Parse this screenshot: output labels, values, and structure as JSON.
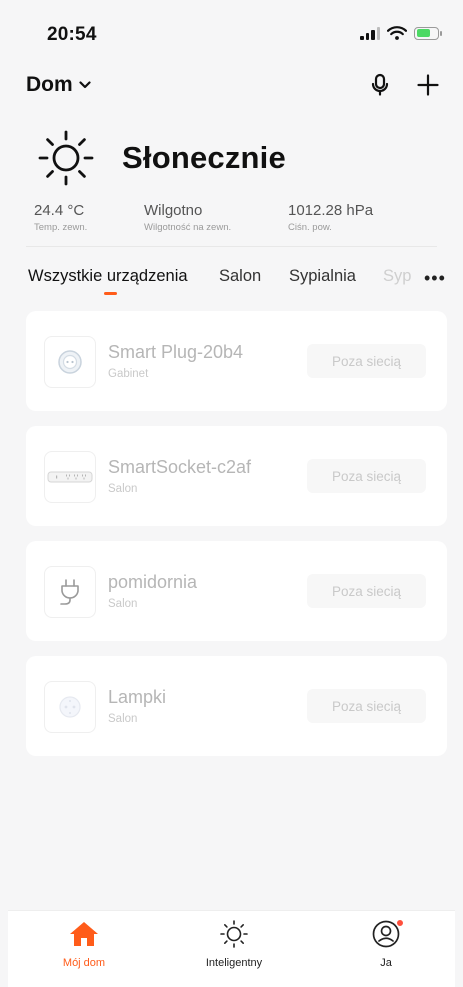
{
  "status_bar": {
    "time": "20:54"
  },
  "header": {
    "home_name": "Dom"
  },
  "weather": {
    "condition": "Słonecznie",
    "metrics": [
      {
        "value": "24.4 °C",
        "label": "Temp. zewn."
      },
      {
        "value": "Wilgotno",
        "label": "Wilgotność na zewn."
      },
      {
        "value": "1012.28 hPa",
        "label": "Ciśn. pow."
      }
    ]
  },
  "tabs": {
    "items": [
      {
        "label": "Wszystkie urządzenia"
      },
      {
        "label": "Salon"
      },
      {
        "label": "Sypialnia"
      },
      {
        "label": "Syp"
      }
    ],
    "more": "•••"
  },
  "devices": [
    {
      "name": "Smart Plug-20b4",
      "room": "Gabinet",
      "status": "Poza siecią",
      "icon": "round-plug-icon"
    },
    {
      "name": "SmartSocket-c2af",
      "room": "Salon",
      "status": "Poza siecią",
      "icon": "power-strip-icon"
    },
    {
      "name": "pomidornia",
      "room": "Salon",
      "status": "Poza siecią",
      "icon": "plug-cable-icon"
    },
    {
      "name": "Lampki",
      "room": "Salon",
      "status": "Poza siecią",
      "icon": "round-socket-icon"
    }
  ],
  "bottom_nav": {
    "items": [
      {
        "label": "Mój dom",
        "icon": "home-icon"
      },
      {
        "label": "Inteligentny",
        "icon": "sun-icon"
      },
      {
        "label": "Ja",
        "icon": "profile-icon"
      }
    ]
  },
  "colors": {
    "accent": "#ff5c1a",
    "badge": "#ff4f3c",
    "battery": "#4cd964"
  }
}
